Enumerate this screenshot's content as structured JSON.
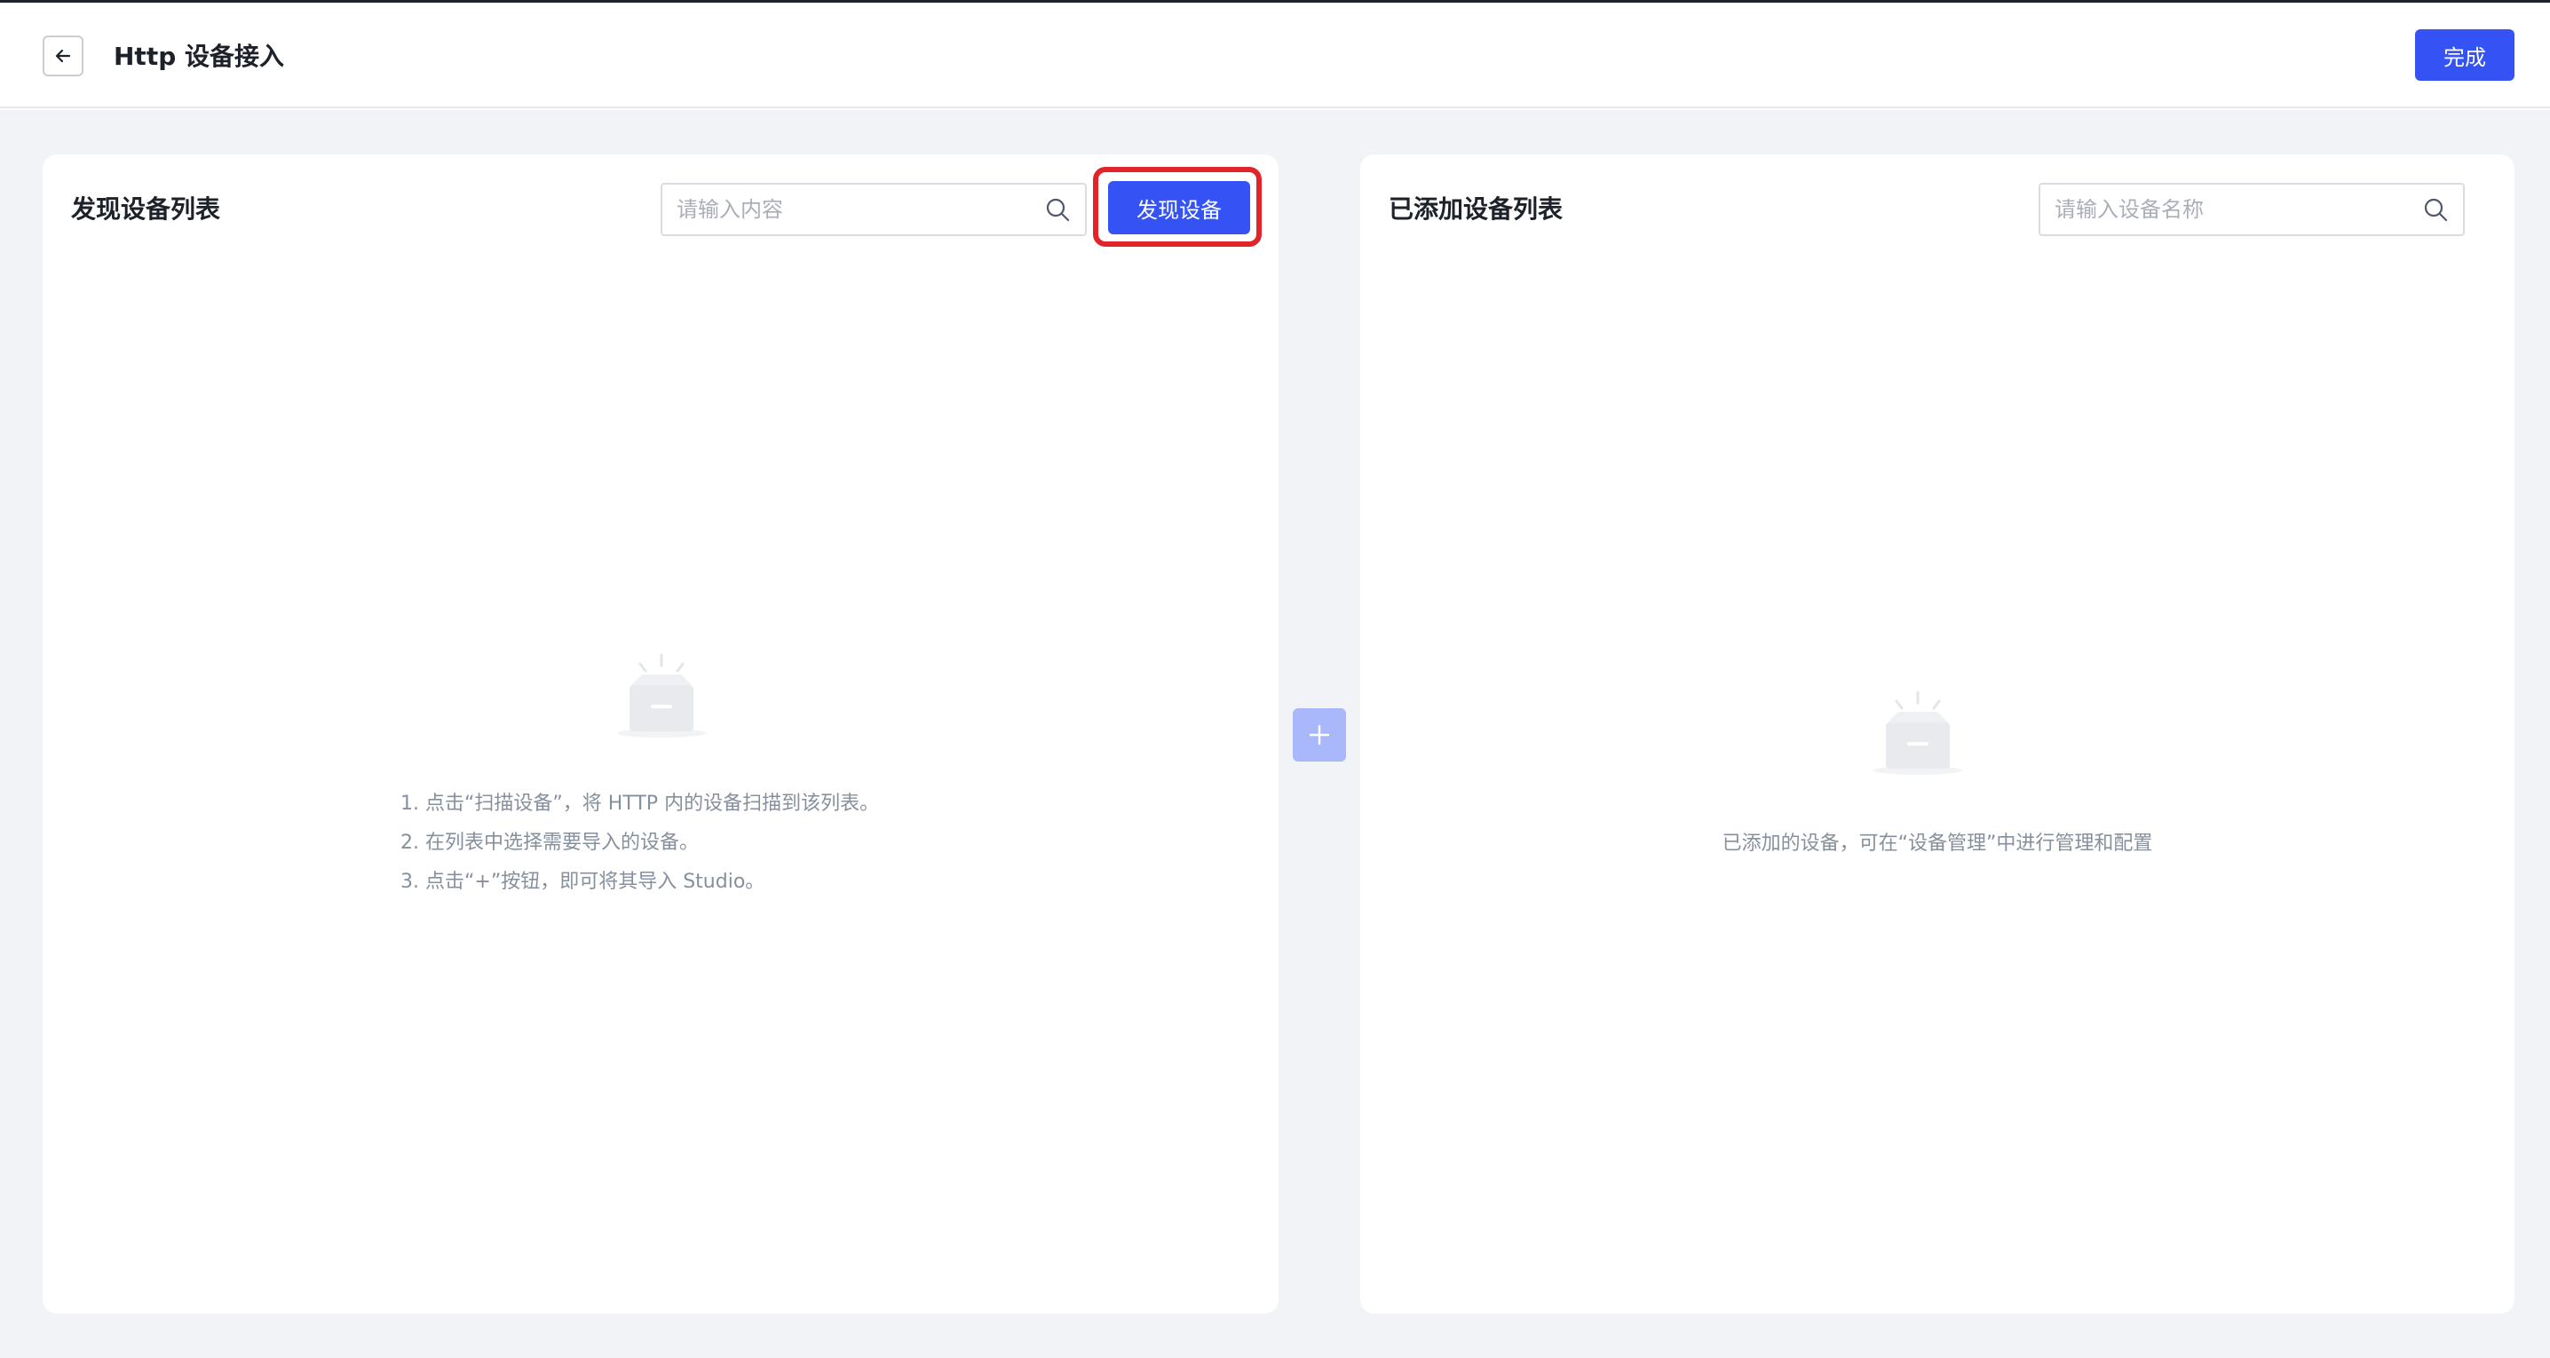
{
  "header": {
    "title": "Http 设备接入",
    "done_label": "完成"
  },
  "discover_panel": {
    "title": "发现设备列表",
    "search_placeholder": "请输入内容",
    "discover_button_label": "发现设备",
    "instructions": [
      "1. 点击“扫描设备”，将 HTTP 内的设备扫描到该列表。",
      "2. 在列表中选择需要导入的设备。",
      "3. 点击“+”按钮，即可将其导入 Studio。"
    ]
  },
  "added_panel": {
    "title": "已添加设备列表",
    "search_placeholder": "请输入设备名称",
    "empty_text": "已添加的设备，可在“设备管理”中进行管理和配置"
  },
  "colors": {
    "primary": "#3552f5",
    "highlight_outline": "#e0242a",
    "add_button_disabled": "#a9b8fb",
    "workspace_bg": "#f2f3f7"
  },
  "icons": {
    "back": "arrow-left-icon",
    "search": "search-icon",
    "empty": "empty-box-icon",
    "add": "plus-icon"
  }
}
